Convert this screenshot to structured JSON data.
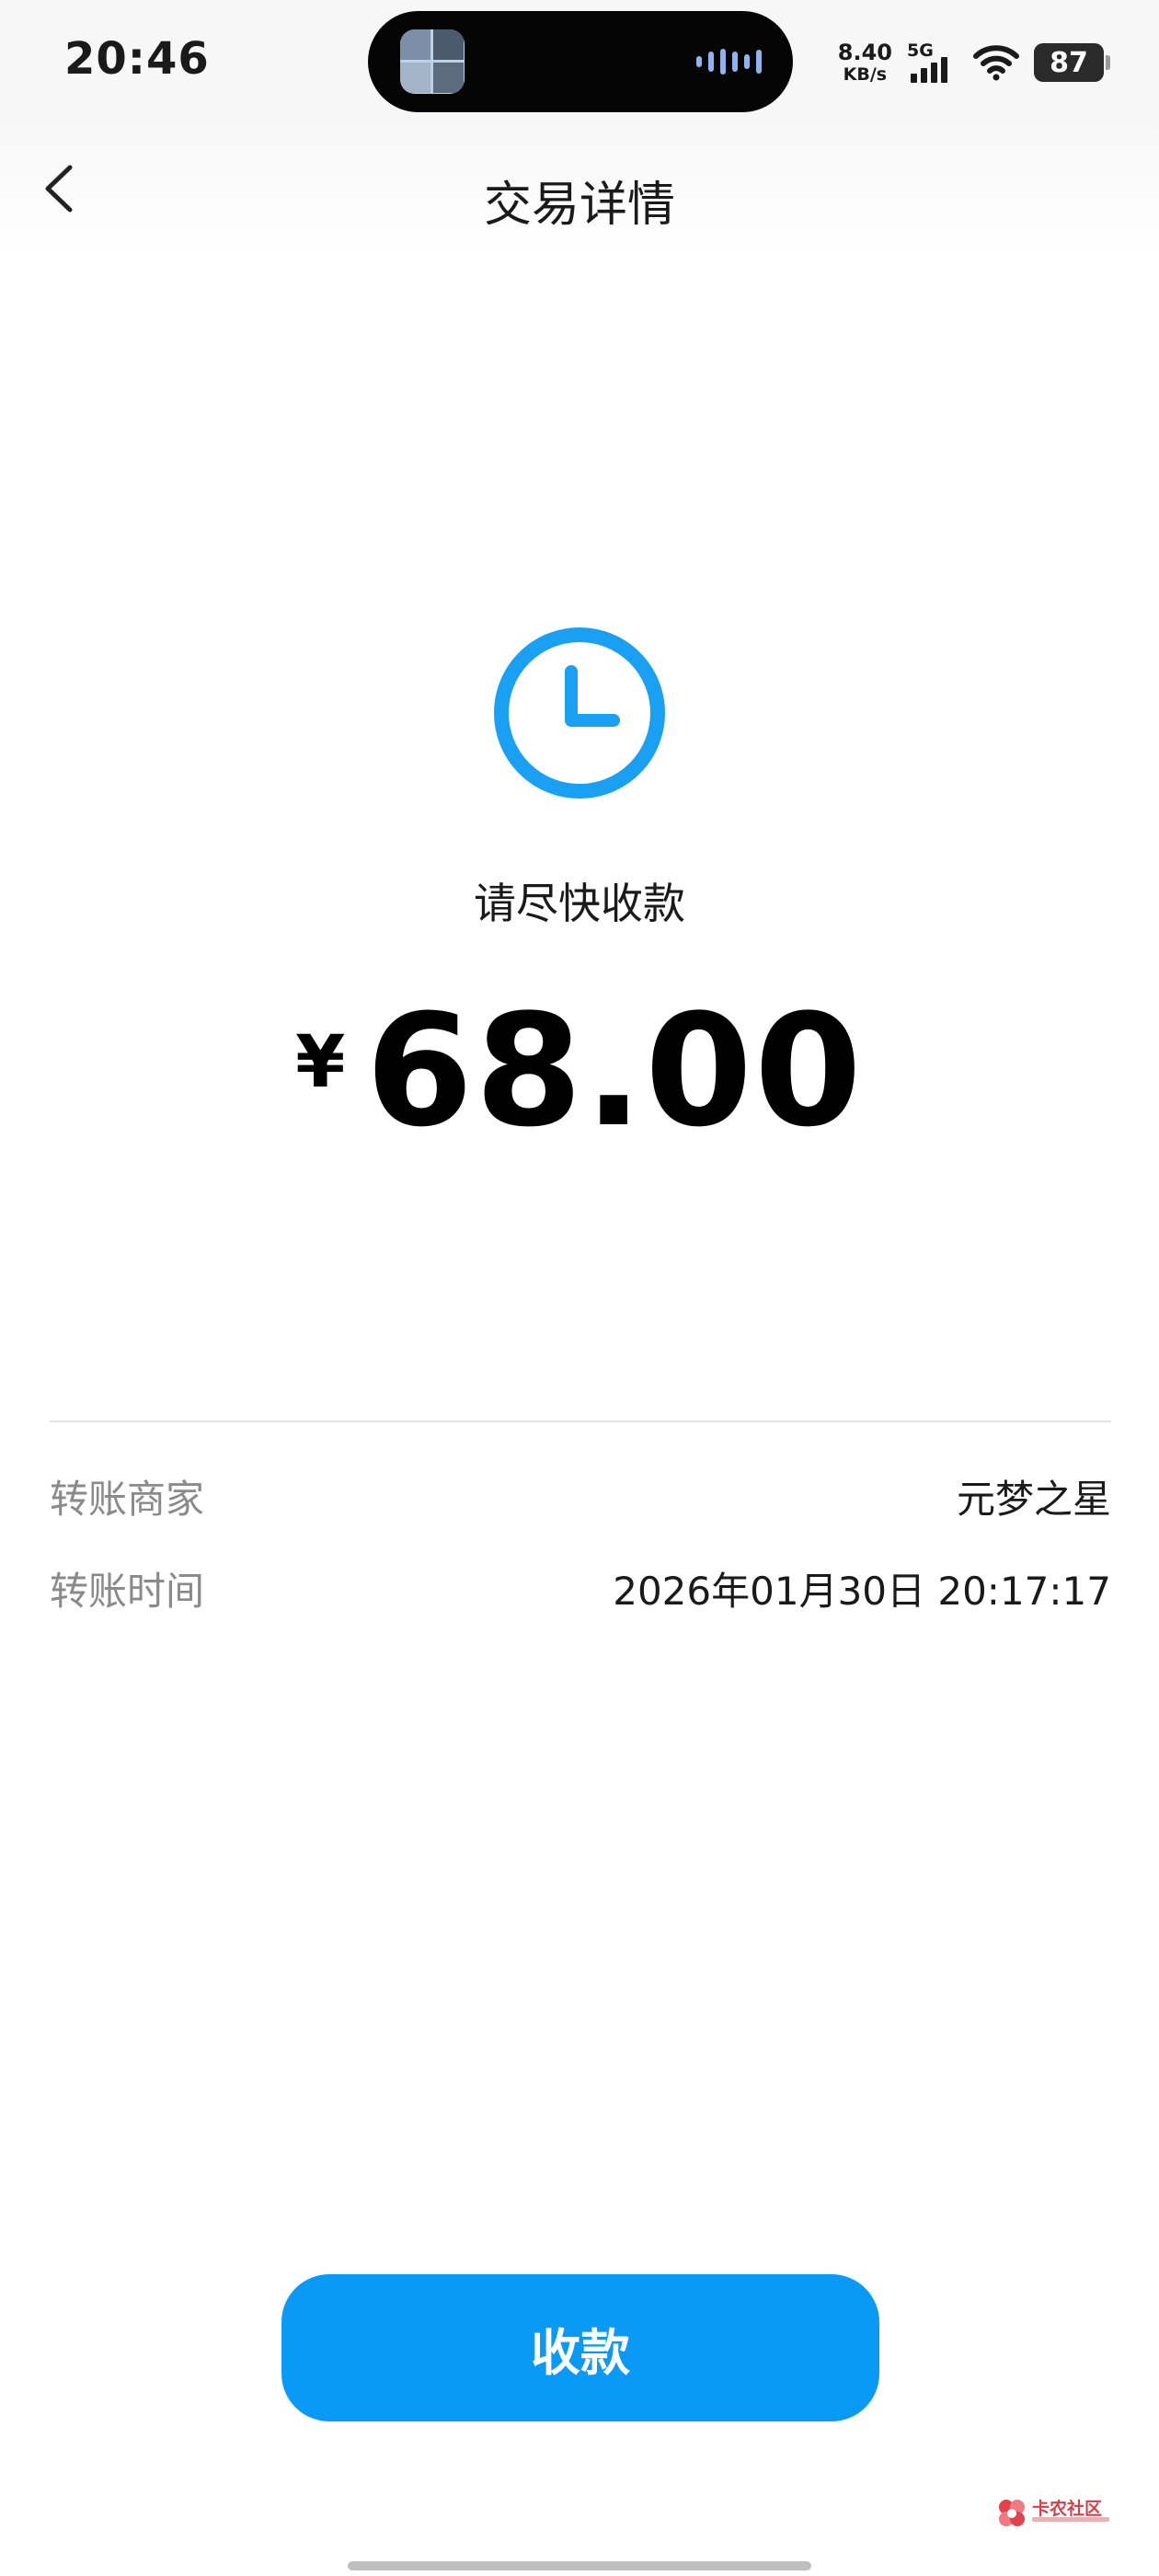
{
  "status_bar": {
    "time": "20:46",
    "net_speed_value": "8.40",
    "net_speed_unit": "KB/s",
    "network_type": "5G",
    "battery_level": "87",
    "icons": [
      "dynamic-island",
      "signal-bars-icon",
      "wifi-icon",
      "battery-icon"
    ]
  },
  "nav": {
    "title": "交易详情",
    "back_icon": "chevron-left-icon"
  },
  "main": {
    "status_icon": "clock-icon",
    "status_text": "请尽快收款",
    "currency_symbol": "¥",
    "amount": "68.00",
    "details": [
      {
        "label": "转账商家",
        "value": "元梦之星"
      },
      {
        "label": "转账时间",
        "value": "2026年01月30日 20:17:17"
      }
    ]
  },
  "actions": {
    "receive_label": "收款"
  },
  "watermark": {
    "text": "卡农社区"
  },
  "colors": {
    "accent": "#0a9af5",
    "clock_icon": "#1aa0f2",
    "label_gray": "#8a8a8a",
    "divider": "#e3e3e3"
  }
}
